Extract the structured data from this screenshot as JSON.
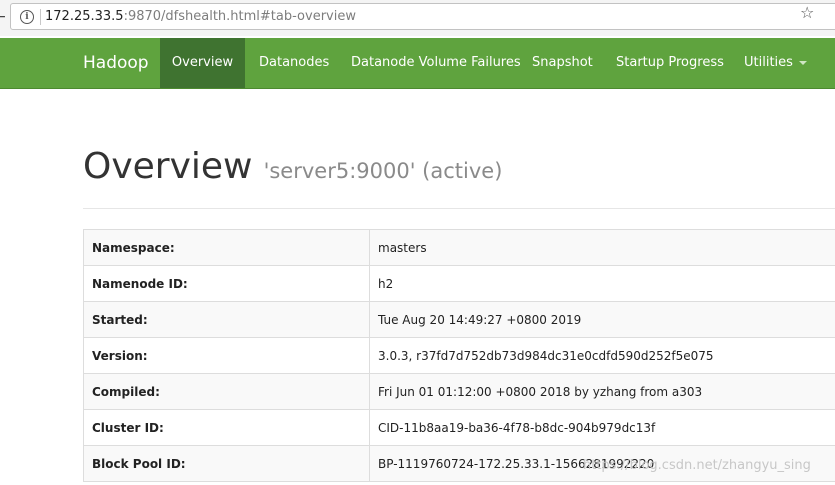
{
  "browser": {
    "url_host": "172.25.33.5",
    "url_rest": ":9870/dfshealth.html#tab-overview"
  },
  "navbar": {
    "brand": "Hadoop",
    "items": [
      {
        "label": "Overview",
        "active": true
      },
      {
        "label": "Datanodes"
      },
      {
        "label": "Datanode Volume Failures"
      },
      {
        "label": "Snapshot"
      },
      {
        "label": "Startup Progress"
      },
      {
        "label": "Utilities"
      }
    ]
  },
  "header": {
    "title": "Overview",
    "subtitle": "'server5:9000' (active)"
  },
  "overview": {
    "rows": [
      {
        "key": "Namespace:",
        "value": "masters"
      },
      {
        "key": "Namenode ID:",
        "value": "h2"
      },
      {
        "key": "Started:",
        "value": "Tue Aug 20 14:49:27 +0800 2019"
      },
      {
        "key": "Version:",
        "value": "3.0.3, r37fd7d752db73d984dc31e0cdfd590d252f5e075"
      },
      {
        "key": "Compiled:",
        "value": "Fri Jun 01 01:12:00 +0800 2018 by yzhang from a303"
      },
      {
        "key": "Cluster ID:",
        "value": "CID-11b8aa19-ba36-4f78-b8dc-904b979dc13f"
      },
      {
        "key": "Block Pool ID:",
        "value": "BP-1119760724-172.25.33.1-1566281992220"
      }
    ]
  },
  "watermark": "https://blog.csdn.net/zhangyu_sing",
  "colors": {
    "navbar": "#5fa33e",
    "nav_active": "#3f7330"
  }
}
